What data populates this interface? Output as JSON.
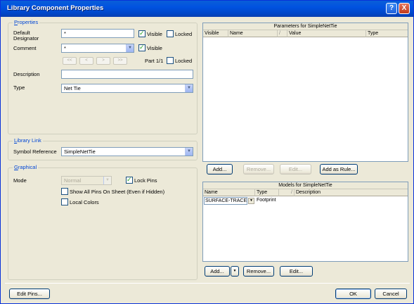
{
  "window": {
    "title": "Library Component Properties",
    "help": "?",
    "close": "X"
  },
  "properties": {
    "group_label_first": "P",
    "group_label_rest": "roperties",
    "default_designator_label_1": "Default",
    "default_designator_label_2": "Designator",
    "default_designator_value": "*",
    "visible_label": "Visible",
    "locked_label": "Locked",
    "comment_label": "Comment",
    "comment_value": "*",
    "comment_visible_label": "Visible",
    "nav": [
      "<<",
      "<",
      ">",
      ">>"
    ],
    "part_label": "Part 1/1",
    "part_locked_label": "Locked",
    "description_label": "Description",
    "description_value": "",
    "type_label": "Type",
    "type_value": "Net Tie"
  },
  "library_link": {
    "group_label_first": "L",
    "group_label_rest": "ibrary Link",
    "symbol_ref_label": "Symbol Reference",
    "symbol_ref_value": "SimpleNetTie"
  },
  "graphical": {
    "group_label_first": "G",
    "group_label_rest": "raphical",
    "mode_label": "Mode",
    "mode_value": "Normal",
    "lock_pins_label": "Lock Pins",
    "show_all_pins_label": "Show All Pins On Sheet (Even if Hidden)",
    "local_colors_label": "Local Colors"
  },
  "parameters": {
    "title": "Parameters for SimpleNetTie",
    "columns": [
      "Visible",
      "Name",
      "/",
      "Value",
      "Type"
    ],
    "buttons": {
      "add": "Add...",
      "remove": "Remove...",
      "edit": "Edit...",
      "add_as_rule": "Add as Rule..."
    }
  },
  "models": {
    "title": "Models for SimpleNetTie",
    "columns": [
      "Name",
      "Type",
      "/",
      "Description"
    ],
    "rows": [
      {
        "name": "SURFACE-TRACE",
        "type": "Footprint",
        "description": ""
      }
    ],
    "buttons": {
      "add": "Add...",
      "remove": "Remove...",
      "edit": "Edit..."
    }
  },
  "footer": {
    "edit_pins": "Edit Pins...",
    "ok": "OK",
    "cancel": "Cancel"
  }
}
